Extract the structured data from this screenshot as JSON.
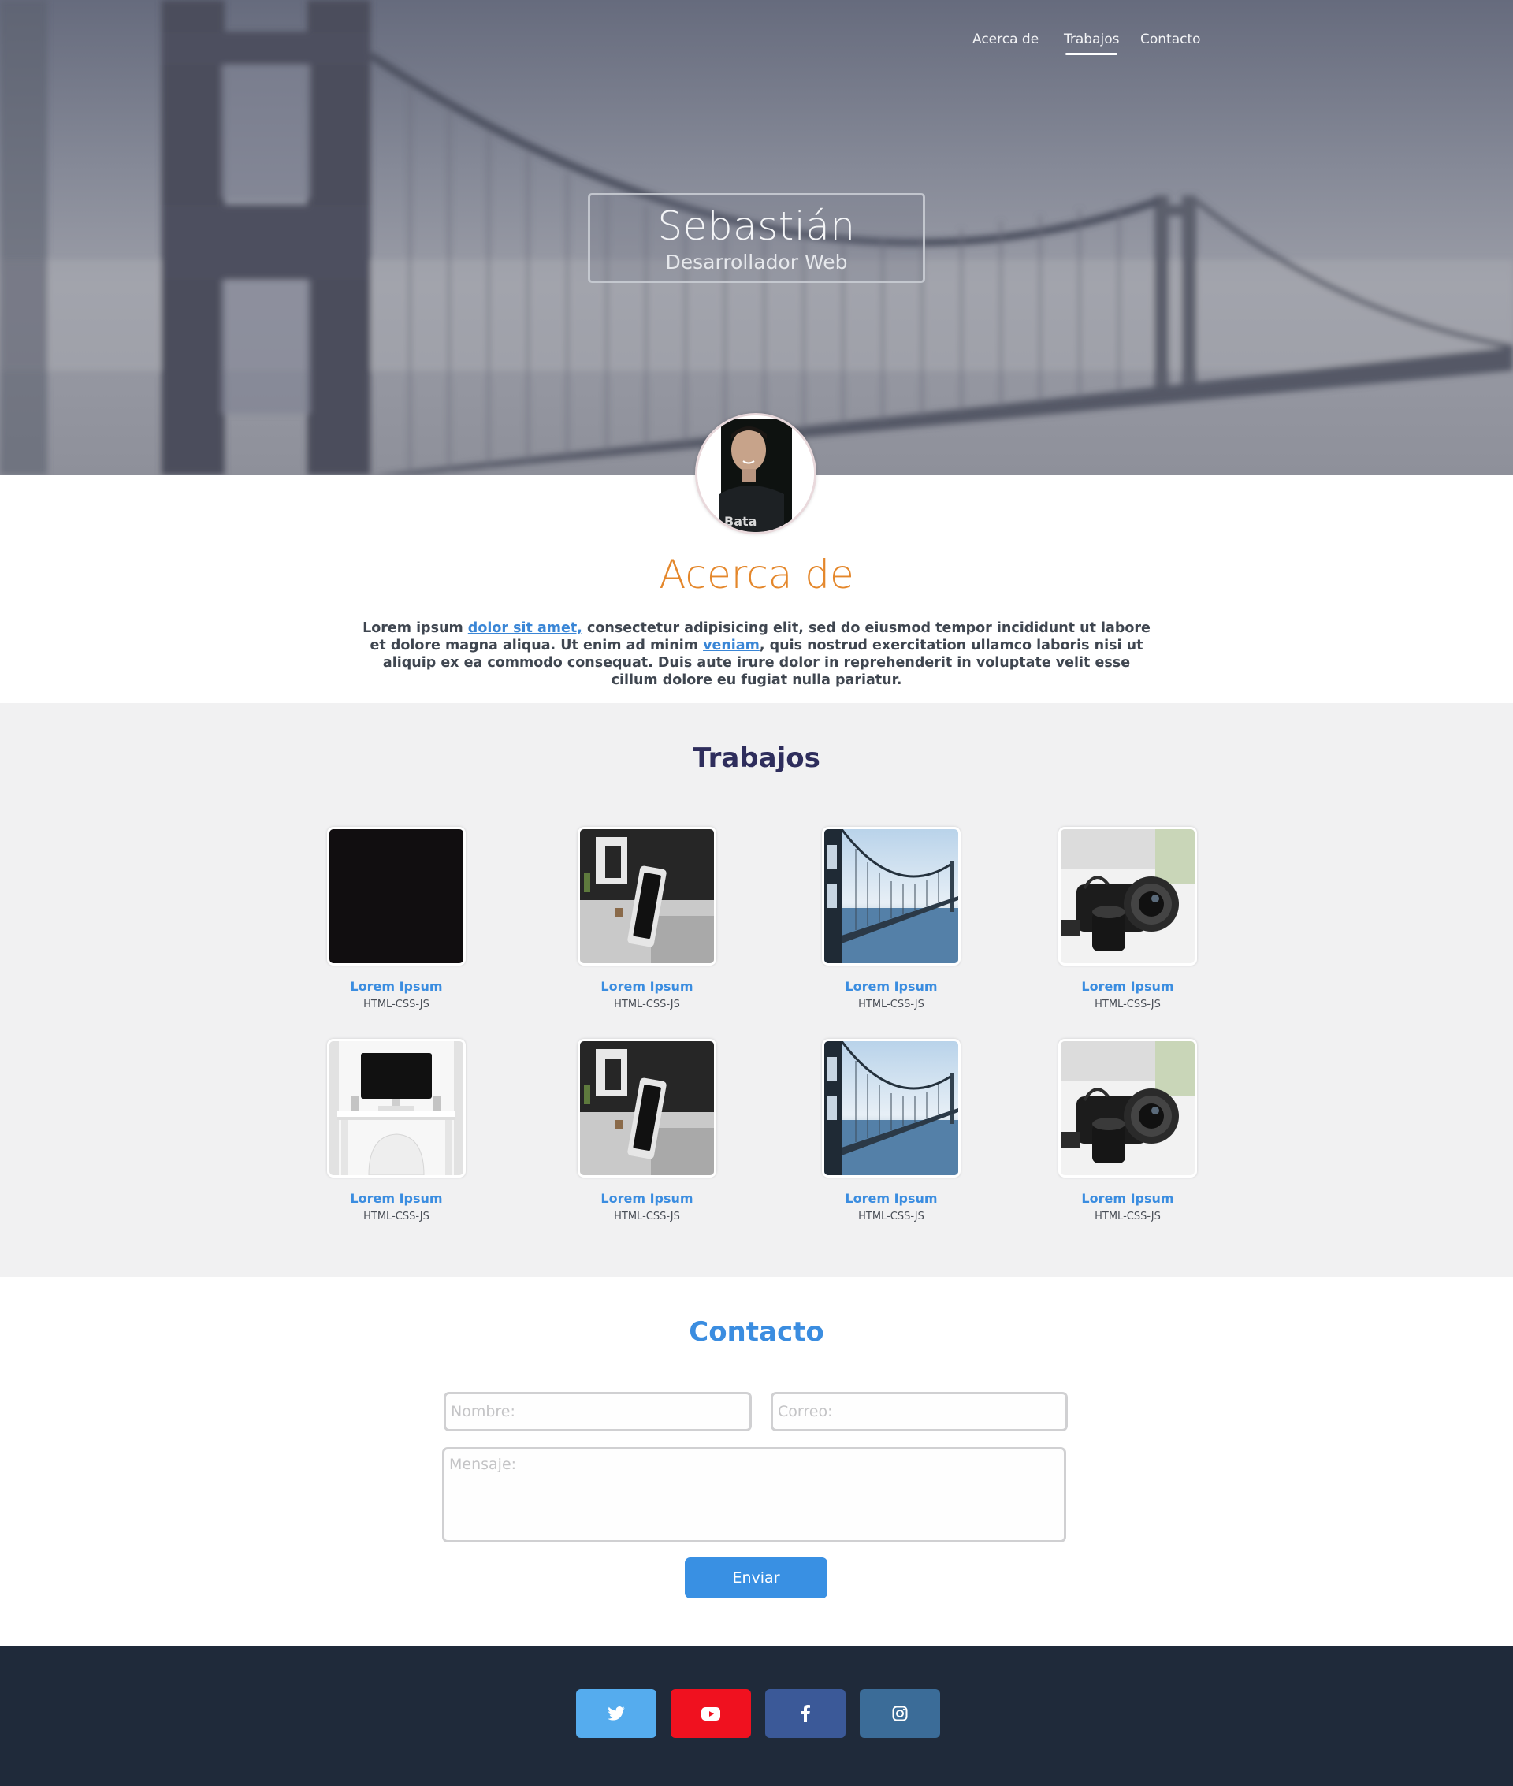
{
  "nav": {
    "items": [
      {
        "label": "Acerca de"
      },
      {
        "label": "Trabajos"
      },
      {
        "label": "Contacto"
      }
    ],
    "active": "Trabajos"
  },
  "hero": {
    "name": "Sebastián",
    "role": "Desarrollador Web"
  },
  "about": {
    "title": "Acerca de",
    "text_part1": "Lorem ipsum ",
    "link1": "dolor sit amet,",
    "text_part2": " consectetur adipisicing elit, sed do eiusmod tempor incididunt ut labore et dolore magna aliqua. Ut enim ad minim ",
    "link2": "veniam",
    "text_part3": ", quis nostrud exercitation ullamco laboris nisi ut aliquip ex ea commodo consequat. Duis aute irure dolor in reprehenderit in voluptate velit esse cillum dolore eu fugiat nulla pariatur."
  },
  "works": {
    "title": "Trabajos",
    "items": [
      {
        "title": "Lorem Ipsum",
        "subtitle": "HTML-CSS-JS",
        "image": "black-square"
      },
      {
        "title": "Lorem Ipsum",
        "subtitle": "HTML-CSS-JS",
        "image": "monitor-phone"
      },
      {
        "title": "Lorem Ipsum",
        "subtitle": "HTML-CSS-JS",
        "image": "bridge"
      },
      {
        "title": "Lorem Ipsum",
        "subtitle": "HTML-CSS-JS",
        "image": "camera"
      },
      {
        "title": "Lorem Ipsum",
        "subtitle": "HTML-CSS-JS",
        "image": "desk-setup"
      },
      {
        "title": "Lorem Ipsum",
        "subtitle": "HTML-CSS-JS",
        "image": "monitor-phone"
      },
      {
        "title": "Lorem Ipsum",
        "subtitle": "HTML-CSS-JS",
        "image": "bridge"
      },
      {
        "title": "Lorem Ipsum",
        "subtitle": "HTML-CSS-JS",
        "image": "camera"
      }
    ]
  },
  "contact": {
    "title": "Contacto",
    "name_placeholder": "Nombre:",
    "email_placeholder": "Correo:",
    "message_placeholder": "Mensaje:",
    "send_label": "Enviar"
  },
  "footer": {
    "social": [
      {
        "icon": "twitter-icon",
        "color": "#55acee"
      },
      {
        "icon": "youtube-icon",
        "color": "#f0111f"
      },
      {
        "icon": "facebook-icon",
        "color": "#3b5998"
      },
      {
        "icon": "instagram-icon",
        "color": "#3b6c98"
      }
    ]
  }
}
